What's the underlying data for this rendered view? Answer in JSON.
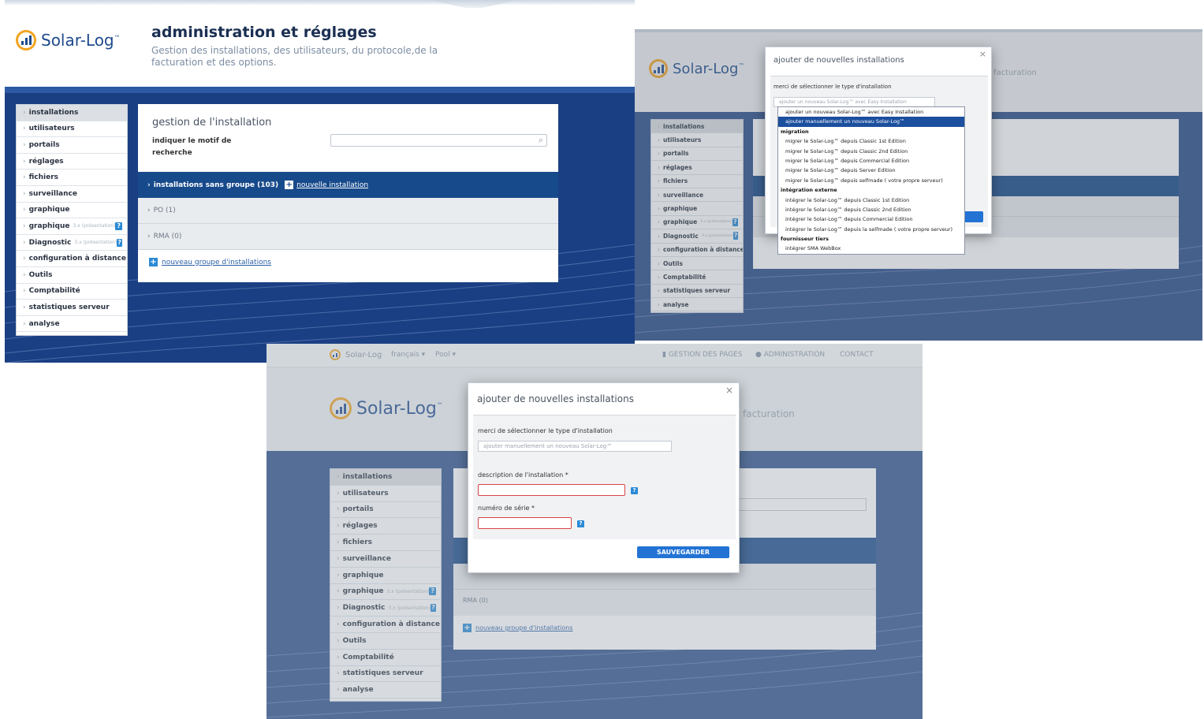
{
  "brand": {
    "name": "Solar-Log",
    "tm": "™"
  },
  "header": {
    "title": "administration et réglages",
    "subtitle": "Gestion des installations, des utilisateurs, du protocole,de la facturation et des options.",
    "subtitle_fragment": "facturation"
  },
  "sidebar": {
    "items": [
      {
        "label": "installations"
      },
      {
        "label": "utilisateurs"
      },
      {
        "label": "portails"
      },
      {
        "label": "réglages"
      },
      {
        "label": "fichiers"
      },
      {
        "label": "surveillance"
      },
      {
        "label": "graphique"
      },
      {
        "label": "graphique",
        "hint": "3.x (présentation)",
        "help": "?"
      },
      {
        "label": "Diagnostic",
        "hint": "3.x (présentation)",
        "help": "?"
      },
      {
        "label": "configuration à distance"
      },
      {
        "label": "Outils"
      },
      {
        "label": "Comptabilité"
      },
      {
        "label": "statistiques serveur"
      },
      {
        "label": "analyse"
      }
    ]
  },
  "main": {
    "title": "gestion de l'installation",
    "search_label": "indiquer le motif de recherche",
    "group_row": {
      "label": "installations sans groupe (103)",
      "link": "nouvelle installation"
    },
    "rows": [
      {
        "label": "PO (1)"
      },
      {
        "label": "RMA (0)"
      }
    ],
    "new_group_link": "nouveau groupe d'installations"
  },
  "modal": {
    "title": "ajouter de nouvelles installations",
    "close": "×",
    "type_label": "merci de sélectionner le type d'installation",
    "type_placeholder": "ajouter un nouveau Solar-Log™ avec Easy Installation",
    "type_selected": "ajouter manuellement un nouveau Solar-Log™",
    "dropdown": [
      {
        "kind": "opt",
        "label": "ajouter un nouveau Solar-Log™ avec Easy Installation"
      },
      {
        "kind": "opt",
        "label": "ajouter manuellement un nouveau Solar-Log™",
        "selected": true
      },
      {
        "kind": "grp",
        "label": "migration"
      },
      {
        "kind": "opt",
        "label": "migrer le Solar-Log™ depuis Classic 1st Edition"
      },
      {
        "kind": "opt",
        "label": "migrer le Solar-Log™ depuis Classic 2nd Edition"
      },
      {
        "kind": "opt",
        "label": "migrer le Solar-Log™ depuis Commercial Edition"
      },
      {
        "kind": "opt",
        "label": "migrer le Solar-Log™ depuis Server Edition"
      },
      {
        "kind": "opt",
        "label": "migrer le Solar-Log™ depuis selfmade ( votre propre serveur)"
      },
      {
        "kind": "grp",
        "label": "intégration externe"
      },
      {
        "kind": "opt",
        "label": "intégrer le Solar-Log™ depuis Classic 1st Edition"
      },
      {
        "kind": "opt",
        "label": "intégrer le Solar-Log™ depuis Classic 2nd Edition"
      },
      {
        "kind": "opt",
        "label": "intégrer le Solar-Log™ depuis Commercial Edition"
      },
      {
        "kind": "opt",
        "label": "intégrer le Solar-Log™ depuis la selfmade ( votre propre serveur)"
      },
      {
        "kind": "grp",
        "label": "fournisseur tiers"
      },
      {
        "kind": "opt",
        "label": "intégrer SMA WebBox"
      }
    ],
    "description_label": "description de l'installation *",
    "serial_label": "numéro de série *",
    "help": "?",
    "save": "SAUVEGARDER"
  },
  "topnav": {
    "language": "français ▾",
    "pool": "Pool ▾",
    "pages": "GESTION DES PAGES",
    "admin": "ADMINISTRATION",
    "contact": "CONTACT"
  },
  "colors": {
    "navy": "#1a3f83",
    "accent_blue": "#2373d4",
    "logo_orange": "#f2a422",
    "error_red": "#d84545"
  }
}
